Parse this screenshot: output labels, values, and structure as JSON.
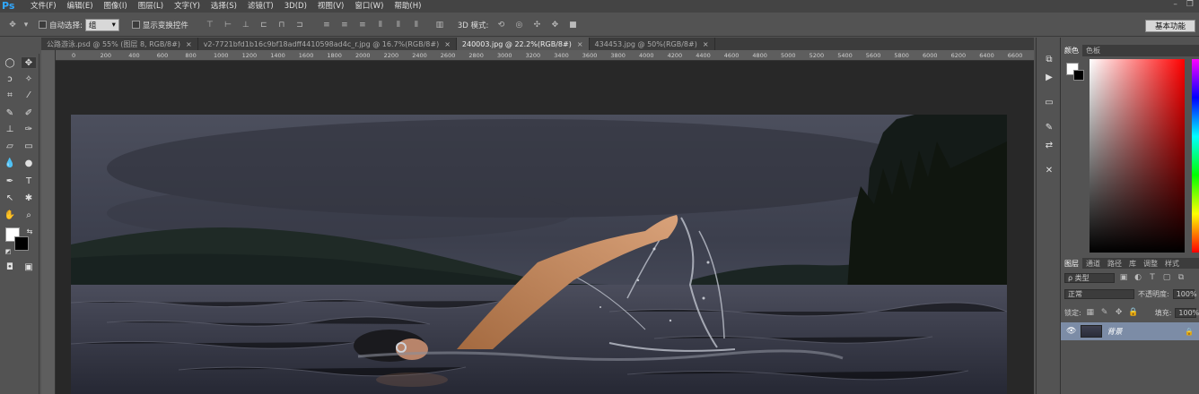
{
  "app": {
    "logo": "Ps"
  },
  "menu": [
    "文件(F)",
    "编辑(E)",
    "图像(I)",
    "图层(L)",
    "文字(Y)",
    "选择(S)",
    "滤镜(T)",
    "3D(D)",
    "视图(V)",
    "窗口(W)",
    "帮助(H)"
  ],
  "options": {
    "auto_select_label": "自动选择:",
    "auto_select_value": "组",
    "show_transform_label": "显示变换控件",
    "mode_3d_label": "3D 模式:",
    "workspace": "基本功能"
  },
  "tabs": [
    {
      "title": "公路游泳.psd @ 55% (图层 8, RGB/8#)",
      "active": false
    },
    {
      "title": "v2-7721bfd1b16c9bf18adff4410598ad4c_r.jpg @ 16.7%(RGB/8#)",
      "active": false
    },
    {
      "title": "240003.jpg @ 22.2%(RGB/8#)",
      "active": true
    },
    {
      "title": "434453.jpg @ 50%(RGB/8#)",
      "active": false
    }
  ],
  "tab_close": "×",
  "ruler_ticks": [
    "0",
    "200",
    "400",
    "600",
    "800",
    "1000",
    "1200",
    "1400",
    "1600",
    "1800",
    "2000",
    "2200",
    "2400",
    "2600",
    "2800",
    "3000",
    "3200",
    "3400",
    "3600",
    "3800",
    "4000",
    "4200",
    "4400",
    "4600",
    "4800",
    "5000",
    "5200",
    "5400",
    "5600",
    "5800",
    "6000",
    "6200",
    "6400",
    "6600"
  ],
  "color_panel": {
    "tabs": [
      "颜色",
      "色板"
    ]
  },
  "layers_panel": {
    "tabs": [
      "图层",
      "通道",
      "路径",
      "库",
      "调整",
      "样式"
    ],
    "filter_label": "ρ 类型",
    "blend_mode": "正常",
    "opacity_label": "不透明度:",
    "opacity_value": "100%",
    "lock_label": "锁定:",
    "fill_label": "填充:",
    "fill_value": "100%",
    "layer_name": "背景"
  },
  "colors": {
    "accent": "#31a8ff",
    "selected_layer": "#7c8ca6"
  }
}
